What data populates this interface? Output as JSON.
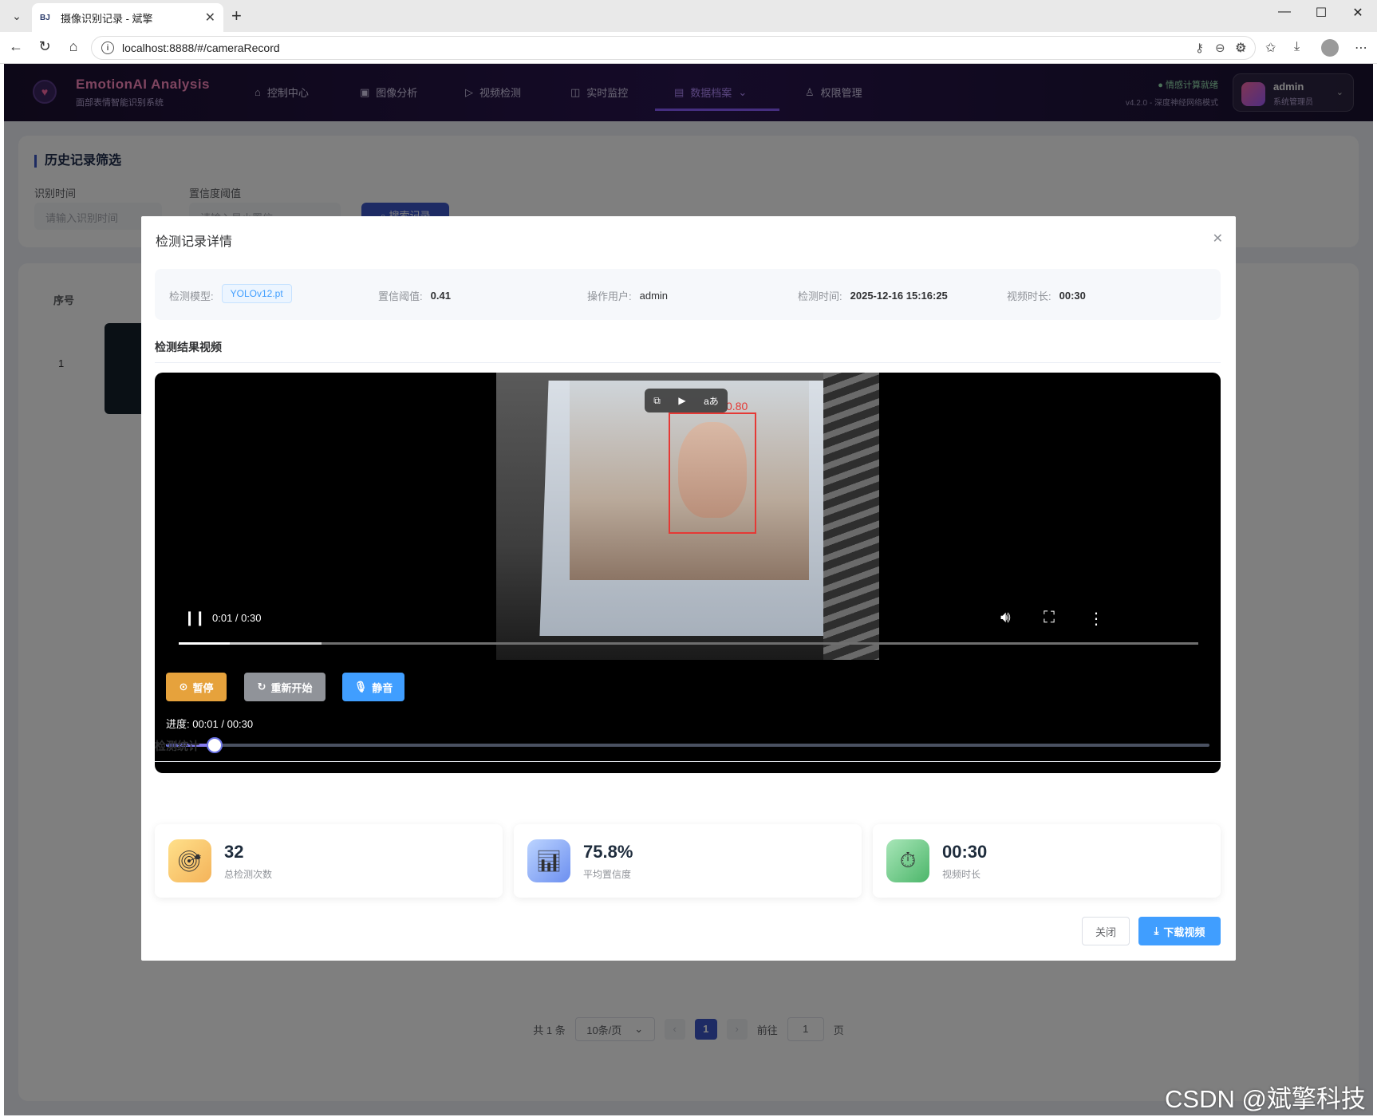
{
  "browser": {
    "tab_title": "摄像识别记录 - 斌擎",
    "tab_favicon": "BJ",
    "url": "localhost:8888/#/cameraRecord"
  },
  "app": {
    "brand_title": "EmotionAI Analysis",
    "brand_subtitle": "面部表情智能识别系统",
    "nav": [
      {
        "label": "控制中心",
        "icon": "home-icon"
      },
      {
        "label": "图像分析",
        "icon": "image-icon"
      },
      {
        "label": "视频检测",
        "icon": "play-circle-icon"
      },
      {
        "label": "实时监控",
        "icon": "camera-icon"
      },
      {
        "label": "数据档案",
        "icon": "document-icon",
        "active": true
      },
      {
        "label": "权限管理",
        "icon": "user-icon"
      }
    ],
    "status_main": "情感计算就绪",
    "status_sub": "v4.2.0 - 深度神经网络模式",
    "user_name": "admin",
    "user_role": "系统管理员"
  },
  "filter": {
    "title": "历史记录筛选",
    "time_label": "识别时间",
    "time_placeholder": "请输入识别时间",
    "threshold_label": "置信度阈值",
    "threshold_placeholder": "请输入最小置信",
    "search_label": "搜索记录"
  },
  "table": {
    "col_seq": "序号",
    "rows": [
      {
        "seq": "1"
      }
    ]
  },
  "pagination": {
    "total": "共 1 条",
    "page_size": "10条/页",
    "current": "1",
    "goto_label": "前往",
    "goto_value": "1",
    "page_suffix": "页"
  },
  "modal": {
    "title": "检测记录详情",
    "info": {
      "model_label": "检测模型:",
      "model_value": "YOLOv12.pt",
      "conf_label": "置信阈值:",
      "conf_value": "0.41",
      "user_label": "操作用户:",
      "user_value": "admin",
      "time_label": "检测时间:",
      "time_value": "2025-12-16 15:16:25",
      "duration_label": "视频时长:",
      "duration_value": "00:30"
    },
    "video_section_title": "检测结果视频",
    "video": {
      "detection_score": "0.80",
      "player_time": "0:01 / 0:30",
      "played_fraction": 0.05,
      "buffered_fraction": 0.14,
      "pause_label": "暂停",
      "restart_label": "重新开始",
      "mute_label": "静音",
      "progress_text": "进度: 00:01 / 00:30",
      "progress_fraction": 0.047
    },
    "stats_section_title": "检测统计",
    "stats": [
      {
        "value": "32",
        "label": "总检测次数",
        "icon": "target-icon"
      },
      {
        "value": "75.8%",
        "label": "平均置信度",
        "icon": "bar-chart-icon"
      },
      {
        "value": "00:30",
        "label": "视频时长",
        "icon": "stopwatch-icon"
      }
    ],
    "close_label": "关闭",
    "download_label": "下载视频"
  },
  "watermark": "CSDN @斌擎科技"
}
